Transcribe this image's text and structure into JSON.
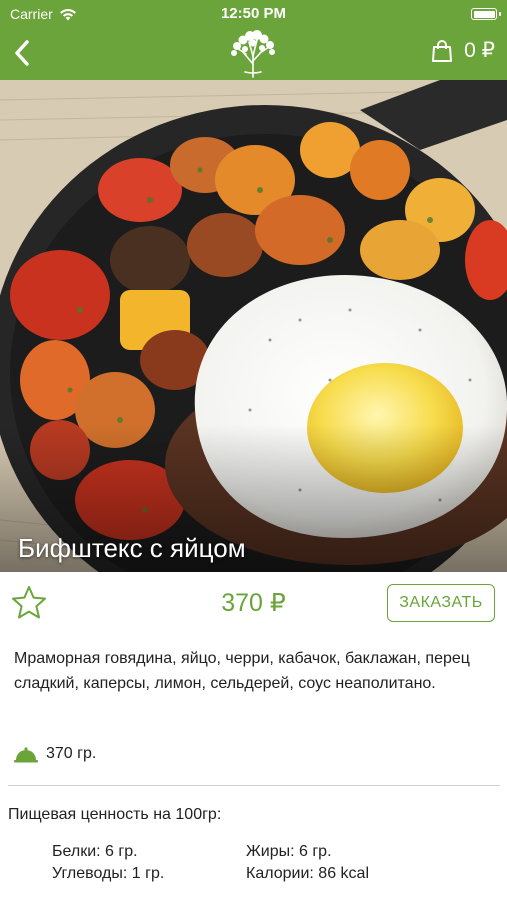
{
  "status": {
    "carrier": "Carrier",
    "time": "12:50 PM"
  },
  "nav": {
    "cart_count": "0 ₽"
  },
  "product": {
    "title": "Бифштекс с яйцом",
    "price": "370 ₽",
    "order_label": "ЗАКАЗАТЬ",
    "description": "Мраморная говядина, яйцо, черри, кабачок, баклажан, перец сладкий, каперсы, лимон, сельдерей, соус неаполитано.",
    "weight": "370 гр."
  },
  "nutrition": {
    "title": "Пищевая ценность на 100гр:",
    "protein": "Белки: 6 гр.",
    "fat": "Жиры: 6 гр.",
    "carbs": "Углеводы: 1 гр.",
    "calories": "Калории: 86 kcal"
  },
  "colors": {
    "brand": "#6ba43a"
  },
  "icons": [
    "wifi-icon",
    "battery-icon",
    "back-chevron-icon",
    "tree-logo-icon",
    "shopping-bag-icon",
    "star-outline-icon",
    "dish-cloche-icon"
  ]
}
